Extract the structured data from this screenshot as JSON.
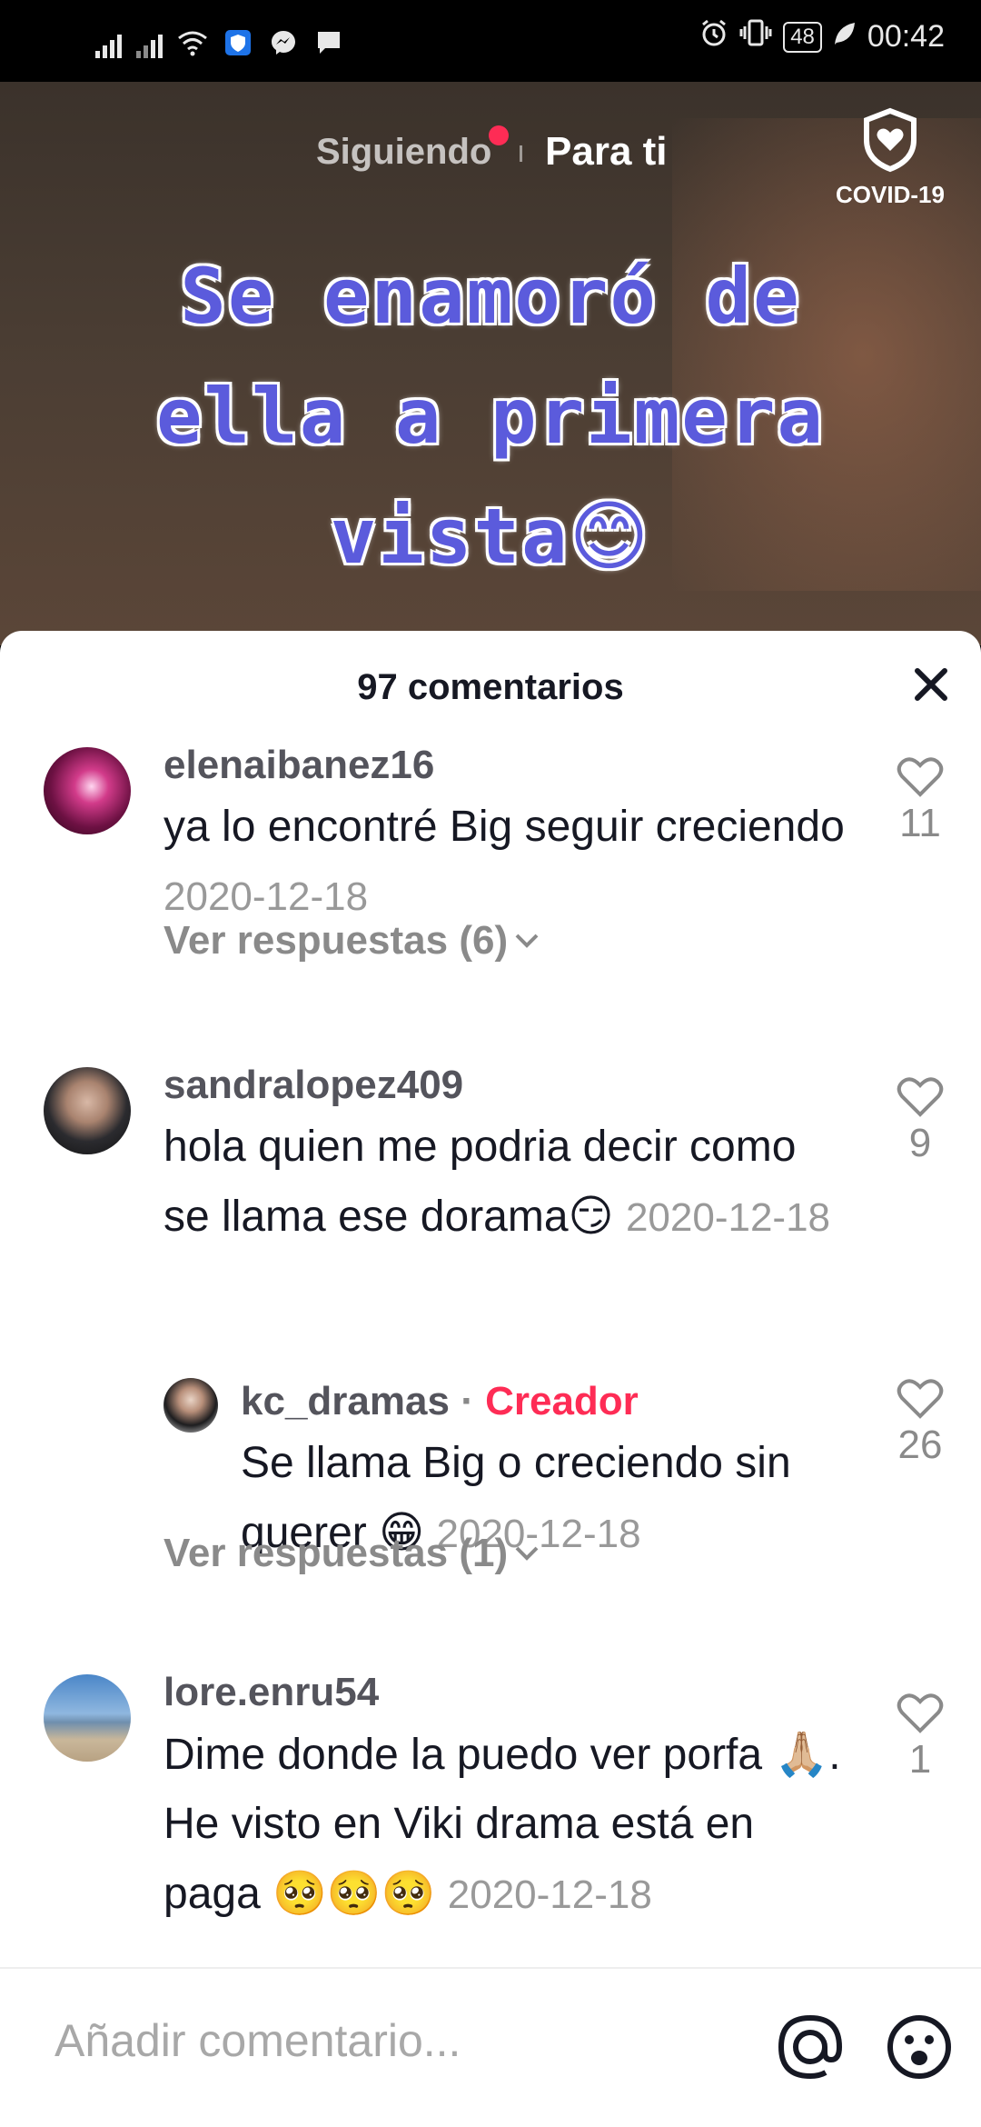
{
  "status_bar": {
    "time": "00:42",
    "battery": "48",
    "icons": [
      "signal-icon",
      "signal-icon",
      "wifi-icon",
      "shield-app-icon",
      "messenger-icon",
      "chat-icon",
      "alarm-icon",
      "vibrate-icon",
      "battery-icon",
      "leaf-icon"
    ]
  },
  "video": {
    "nav": {
      "following": "Siguiendo",
      "for_you": "Para ti"
    },
    "covid_label": "COVID-19",
    "caption_line1": "Se enamoró de",
    "caption_line2": "ella a primera",
    "caption_line3": "vista",
    "caption_emoji": "😊"
  },
  "comments_sheet": {
    "title": "97 comentarios",
    "comments": [
      {
        "username": "elenaibanez16",
        "text": "ya lo encontré Big seguir creciendo",
        "date": "2020-12-18",
        "likes": "11",
        "replies_label": "Ver respuestas (6)"
      },
      {
        "username": "sandralopez409",
        "text": "hola quien me podria decir como se llama ese dorama",
        "emoji": "😏",
        "date": "2020-12-18",
        "likes": "9",
        "reply": {
          "username": "kc_dramas",
          "separator": "·",
          "badge": "Creador",
          "text": "Se llama Big o creciendo sin querer",
          "emoji": "😁",
          "date": "2020-12-18",
          "likes": "26"
        },
        "replies_label": "Ver respuestas (1)"
      },
      {
        "username": "lore.enru54",
        "text_part1": "Dime donde la puedo ver porfa",
        "emoji1": "🙏🏼",
        "text_part2": ". He visto en Viki drama está en paga",
        "emoji2": "🥺🥺🥺",
        "date": "2020-12-18",
        "likes": "1"
      }
    ]
  },
  "input": {
    "placeholder": "Añadir comentario..."
  }
}
